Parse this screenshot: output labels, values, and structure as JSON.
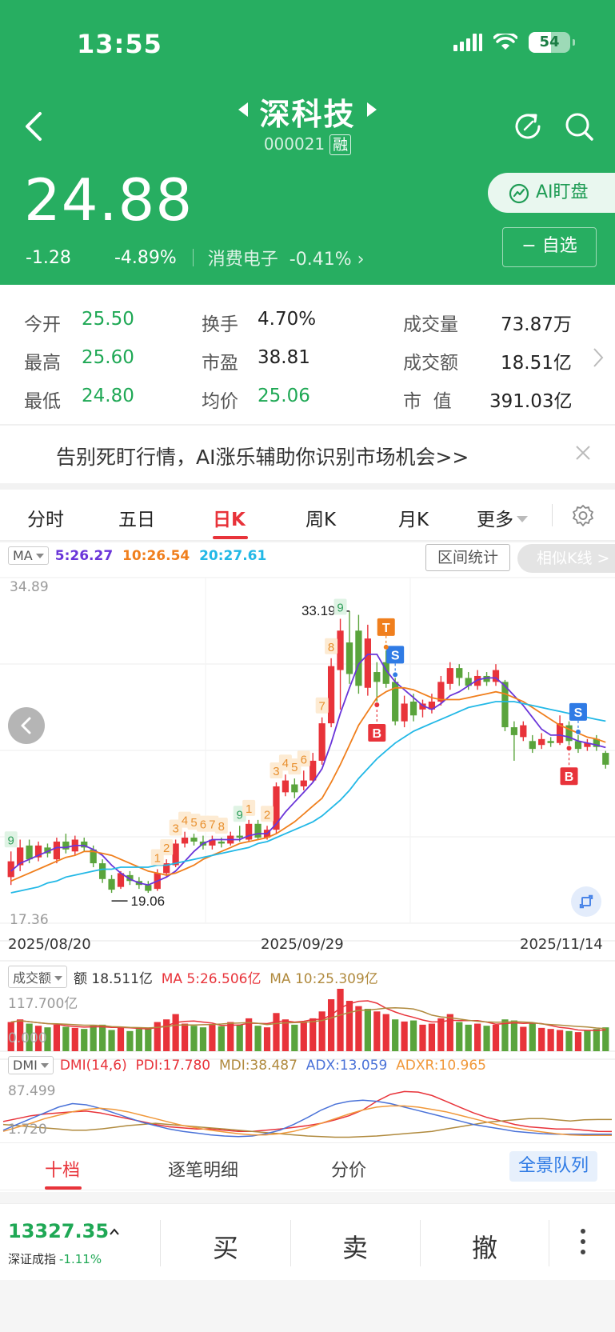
{
  "status_bar": {
    "time": "13:55",
    "battery": "54"
  },
  "header": {
    "stock_name": "深科技",
    "stock_code": "000021",
    "margin_tag": "融",
    "price": "24.88",
    "change": "-1.28",
    "change_pct": "-4.89%",
    "sector": "消费电子",
    "sector_pct": "-0.41%",
    "ai_button": "AI盯盘",
    "watchlist_button": "− 自选",
    "colors": {
      "header_bg": "#27ae61",
      "down": "#1fa855",
      "up": "#e8333a"
    }
  },
  "quote": {
    "items": [
      {
        "label": "今开",
        "value": "25.50"
      },
      {
        "label": "最高",
        "value": "25.60"
      },
      {
        "label": "最低",
        "value": "24.80"
      },
      {
        "label": "换手",
        "value": "4.70%"
      },
      {
        "label": "市盈",
        "value": "38.81"
      },
      {
        "label": "均价",
        "value": "25.06"
      },
      {
        "label": "成交量",
        "value": "73.87万"
      },
      {
        "label": "成交额",
        "value": "18.51亿"
      },
      {
        "label": "市  值",
        "value": "391.03亿"
      }
    ]
  },
  "banner": {
    "text": "告别死盯行情，AI涨乐辅助你识别市场机会>>"
  },
  "period_tabs": {
    "items": [
      "分时",
      "五日",
      "日K",
      "周K",
      "月K",
      "更多"
    ],
    "active": "日K"
  },
  "kline": {
    "ma_selector": "MA",
    "ma5": "5:26.27",
    "ma10": "10:26.54",
    "ma20": "20:27.61",
    "range_stats_button": "区间统计",
    "similar_kline_button": "相似K线 >",
    "y_max": "34.89",
    "y_min": "17.36",
    "high_mark": "33.19",
    "low_mark": "19.06",
    "x_labels": [
      "2025/08/20",
      "2025/09/29",
      "2025/11/14"
    ],
    "signals": {
      "buy": "B",
      "sell": "S",
      "t": "T"
    },
    "counts": [
      "9",
      "1",
      "2",
      "3",
      "4",
      "5",
      "6",
      "7",
      "8",
      "9",
      "1",
      "2",
      "3",
      "4",
      "5",
      "6",
      "7",
      "8",
      "9"
    ],
    "colors": {
      "ma5": "#6a35d9",
      "ma10": "#f07f1d",
      "ma20": "#22b8e6"
    }
  },
  "volume": {
    "selector": "成交额",
    "amount": "额 18.511亿",
    "ma5": "MA 5:26.506亿",
    "ma10": "MA 10:25.309亿",
    "y_max": "117.700亿",
    "y_min": "0.000"
  },
  "dmi": {
    "selector": "DMI",
    "params": "DMI(14,6)",
    "pdi": "PDI:17.780",
    "mdi": "MDI:38.487",
    "adx": "ADX:13.059",
    "adxr": "ADXR:10.965",
    "y_max": "87.499",
    "y_min": "1.720"
  },
  "bottom_tabs": {
    "items": [
      "十档",
      "逐笔明细",
      "分价"
    ],
    "active": "十档",
    "panorama": "全景队列"
  },
  "bottom_bar": {
    "index_value": "13327.35",
    "index_name": "深证成指",
    "index_pct": "-1.11%",
    "buy": "买",
    "sell": "卖",
    "cancel": "撤"
  },
  "chart_data": {
    "type": "candlestick",
    "title": "深科技 日K",
    "xlabel": "",
    "ylabel": "",
    "ylim": [
      17.36,
      34.89
    ],
    "x_ticks": [
      "2025/08/20",
      "2025/09/29",
      "2025/11/14"
    ],
    "candles": [
      {
        "o": 19.7,
        "c": 20.5,
        "h": 21.0,
        "l": 19.3
      },
      {
        "o": 20.3,
        "c": 21.2,
        "h": 21.6,
        "l": 20.0
      },
      {
        "o": 21.3,
        "c": 20.6,
        "h": 21.6,
        "l": 20.4
      },
      {
        "o": 20.7,
        "c": 21.3,
        "h": 21.5,
        "l": 20.5
      },
      {
        "o": 21.2,
        "c": 20.9,
        "h": 21.4,
        "l": 20.7
      },
      {
        "o": 20.6,
        "c": 21.5,
        "h": 21.7,
        "l": 20.4
      },
      {
        "o": 21.5,
        "c": 21.1,
        "h": 21.9,
        "l": 20.9
      },
      {
        "o": 21.0,
        "c": 21.6,
        "h": 21.8,
        "l": 20.8
      },
      {
        "o": 21.5,
        "c": 21.2,
        "h": 21.7,
        "l": 21.0
      },
      {
        "o": 21.1,
        "c": 20.4,
        "h": 21.3,
        "l": 20.2
      },
      {
        "o": 20.4,
        "c": 19.6,
        "h": 20.6,
        "l": 19.4
      },
      {
        "o": 19.6,
        "c": 19.06,
        "h": 19.8,
        "l": 18.9
      },
      {
        "o": 19.2,
        "c": 19.9,
        "h": 20.0,
        "l": 19.1
      },
      {
        "o": 19.8,
        "c": 19.5,
        "h": 20.0,
        "l": 19.3
      },
      {
        "o": 19.5,
        "c": 19.3,
        "h": 19.7,
        "l": 19.1
      },
      {
        "o": 19.3,
        "c": 19.0,
        "h": 19.5,
        "l": 18.9
      },
      {
        "o": 19.1,
        "c": 19.9,
        "h": 20.1,
        "l": 19.0
      },
      {
        "o": 19.9,
        "c": 20.4,
        "h": 20.6,
        "l": 19.7
      },
      {
        "o": 20.3,
        "c": 21.4,
        "h": 21.6,
        "l": 20.2
      },
      {
        "o": 21.4,
        "c": 21.7,
        "h": 22.0,
        "l": 21.2
      },
      {
        "o": 21.7,
        "c": 21.5,
        "h": 21.9,
        "l": 21.3
      },
      {
        "o": 21.5,
        "c": 21.3,
        "h": 21.8,
        "l": 21.1
      },
      {
        "o": 21.3,
        "c": 21.6,
        "h": 21.8,
        "l": 21.1
      },
      {
        "o": 21.5,
        "c": 21.4,
        "h": 21.7,
        "l": 21.2
      },
      {
        "o": 21.4,
        "c": 21.8,
        "h": 22.0,
        "l": 21.3
      },
      {
        "o": 21.8,
        "c": 21.7,
        "h": 22.3,
        "l": 21.5
      },
      {
        "o": 21.6,
        "c": 22.4,
        "h": 22.6,
        "l": 21.5
      },
      {
        "o": 22.4,
        "c": 21.7,
        "h": 22.6,
        "l": 21.6
      },
      {
        "o": 21.7,
        "c": 22.1,
        "h": 22.3,
        "l": 21.6
      },
      {
        "o": 22.1,
        "c": 24.3,
        "h": 24.5,
        "l": 21.9
      },
      {
        "o": 24.0,
        "c": 24.6,
        "h": 24.9,
        "l": 23.8
      },
      {
        "o": 24.4,
        "c": 24.0,
        "h": 24.7,
        "l": 23.7
      },
      {
        "o": 24.3,
        "c": 24.6,
        "h": 25.1,
        "l": 24.1
      },
      {
        "o": 24.6,
        "c": 25.6,
        "h": 26.0,
        "l": 24.5
      },
      {
        "o": 25.6,
        "c": 27.5,
        "h": 27.8,
        "l": 25.4
      },
      {
        "o": 27.5,
        "c": 30.4,
        "h": 30.8,
        "l": 27.3
      },
      {
        "o": 30.2,
        "c": 32.2,
        "h": 32.8,
        "l": 28.2
      },
      {
        "o": 31.6,
        "c": 30.0,
        "h": 33.19,
        "l": 29.5
      },
      {
        "o": 32.2,
        "c": 29.4,
        "h": 33.0,
        "l": 29.0
      },
      {
        "o": 29.3,
        "c": 31.8,
        "h": 32.5,
        "l": 28.9
      },
      {
        "o": 30.1,
        "c": 29.6,
        "h": 30.6,
        "l": 28.6
      },
      {
        "o": 30.6,
        "c": 29.5,
        "h": 31.2,
        "l": 29.3
      },
      {
        "o": 29.6,
        "c": 27.6,
        "h": 29.8,
        "l": 27.4
      },
      {
        "o": 27.6,
        "c": 28.5,
        "h": 28.9,
        "l": 27.3
      },
      {
        "o": 28.6,
        "c": 27.9,
        "h": 29.0,
        "l": 27.6
      },
      {
        "o": 28.2,
        "c": 28.5,
        "h": 28.7,
        "l": 27.8
      },
      {
        "o": 28.2,
        "c": 28.6,
        "h": 29.0,
        "l": 28.0
      },
      {
        "o": 28.6,
        "c": 29.6,
        "h": 29.9,
        "l": 28.4
      },
      {
        "o": 29.5,
        "c": 30.3,
        "h": 30.6,
        "l": 29.2
      },
      {
        "o": 30.3,
        "c": 29.8,
        "h": 30.5,
        "l": 29.4
      },
      {
        "o": 29.8,
        "c": 29.4,
        "h": 30.1,
        "l": 29.2
      },
      {
        "o": 29.4,
        "c": 29.9,
        "h": 30.2,
        "l": 29.2
      },
      {
        "o": 29.9,
        "c": 29.6,
        "h": 30.1,
        "l": 29.4
      },
      {
        "o": 29.6,
        "c": 30.2,
        "h": 30.5,
        "l": 29.4
      },
      {
        "o": 29.6,
        "c": 27.3,
        "h": 29.7,
        "l": 27.1
      },
      {
        "o": 27.3,
        "c": 26.9,
        "h": 27.6,
        "l": 25.6
      },
      {
        "o": 26.8,
        "c": 27.4,
        "h": 27.6,
        "l": 26.6
      },
      {
        "o": 26.6,
        "c": 26.2,
        "h": 26.9,
        "l": 26.0
      },
      {
        "o": 26.4,
        "c": 26.7,
        "h": 27.0,
        "l": 26.2
      },
      {
        "o": 26.6,
        "c": 26.5,
        "h": 26.8,
        "l": 26.3
      },
      {
        "o": 26.5,
        "c": 27.5,
        "h": 27.9,
        "l": 26.4
      },
      {
        "o": 27.4,
        "c": 26.6,
        "h": 27.6,
        "l": 26.4
      },
      {
        "o": 26.6,
        "c": 26.2,
        "h": 26.9,
        "l": 26.0
      },
      {
        "o": 26.3,
        "c": 26.5,
        "h": 26.7,
        "l": 26.1
      },
      {
        "o": 26.7,
        "c": 26.3,
        "h": 26.9,
        "l": 26.1
      },
      {
        "o": 26.0,
        "c": 25.4,
        "h": 26.1,
        "l": 25.2
      }
    ],
    "series": [
      {
        "name": "MA5",
        "values": [
          20.0,
          20.4,
          20.6,
          20.8,
          21.0,
          21.2,
          21.2,
          21.3,
          21.3,
          21.1,
          20.8,
          20.3,
          19.9,
          19.6,
          19.4,
          19.3,
          19.5,
          19.7,
          20.0,
          20.5,
          21.0,
          21.4,
          21.6,
          21.6,
          21.6,
          21.6,
          21.8,
          21.9,
          21.9,
          22.4,
          23.0,
          23.5,
          24.0,
          24.5,
          25.2,
          26.5,
          28.0,
          29.3,
          30.5,
          31.0,
          31.0,
          30.2,
          29.6,
          29.2,
          28.8,
          28.4,
          28.2,
          28.5,
          28.9,
          29.1,
          29.4,
          29.7,
          29.8,
          29.8,
          29.4,
          28.9,
          28.4,
          27.8,
          27.2,
          26.9,
          26.9,
          26.8,
          26.6,
          26.5,
          26.4,
          26.27
        ]
      },
      {
        "name": "MA10",
        "values": [
          19.5,
          19.7,
          19.9,
          20.1,
          20.3,
          20.5,
          20.7,
          20.8,
          21.0,
          21.0,
          20.9,
          20.8,
          20.6,
          20.4,
          20.2,
          20.0,
          19.9,
          19.8,
          19.9,
          20.1,
          20.3,
          20.6,
          20.8,
          21.0,
          21.2,
          21.4,
          21.5,
          21.6,
          21.7,
          21.9,
          22.2,
          22.5,
          22.9,
          23.3,
          23.7,
          24.5,
          25.4,
          26.4,
          27.4,
          28.1,
          28.8,
          29.1,
          29.3,
          29.3,
          29.2,
          29.0,
          28.8,
          28.7,
          28.7,
          28.7,
          28.8,
          28.9,
          29.0,
          29.1,
          29.0,
          28.8,
          28.6,
          28.3,
          28.0,
          27.7,
          27.4,
          27.2,
          27.0,
          26.8,
          26.7,
          26.54
        ]
      },
      {
        "name": "MA20",
        "values": [
          18.9,
          19.0,
          19.1,
          19.2,
          19.4,
          19.5,
          19.7,
          19.8,
          19.9,
          20.0,
          20.1,
          20.1,
          20.2,
          20.2,
          20.2,
          20.2,
          20.3,
          20.3,
          20.4,
          20.5,
          20.6,
          20.7,
          20.8,
          20.9,
          21.0,
          21.1,
          21.2,
          21.4,
          21.5,
          21.7,
          21.9,
          22.1,
          22.3,
          22.5,
          22.8,
          23.2,
          23.6,
          24.1,
          24.7,
          25.2,
          25.7,
          26.1,
          26.5,
          26.8,
          27.1,
          27.3,
          27.5,
          27.7,
          27.9,
          28.1,
          28.3,
          28.4,
          28.5,
          28.6,
          28.6,
          28.6,
          28.5,
          28.4,
          28.3,
          28.2,
          28.1,
          28.0,
          27.9,
          27.8,
          27.7,
          27.61
        ]
      }
    ],
    "volume": [
      55,
      60,
      52,
      48,
      45,
      50,
      46,
      44,
      42,
      48,
      50,
      40,
      45,
      38,
      42,
      44,
      55,
      60,
      70,
      52,
      48,
      45,
      50,
      47,
      55,
      50,
      62,
      48,
      45,
      72,
      60,
      50,
      55,
      62,
      75,
      98,
      117.7,
      95,
      85,
      80,
      75,
      70,
      60,
      56,
      58,
      50,
      52,
      62,
      70,
      55,
      50,
      52,
      48,
      50,
      60,
      58,
      46,
      52,
      44,
      42,
      40,
      38,
      36,
      40,
      42,
      45
    ],
    "volume_up": [
      true,
      true,
      false,
      true,
      false,
      true,
      false,
      true,
      false,
      false,
      false,
      false,
      true,
      false,
      false,
      false,
      true,
      true,
      true,
      true,
      false,
      false,
      true,
      false,
      true,
      false,
      true,
      false,
      true,
      true,
      true,
      false,
      true,
      true,
      true,
      true,
      true,
      true,
      true,
      false,
      true,
      true,
      false,
      true,
      false,
      true,
      true,
      true,
      true,
      false,
      false,
      true,
      false,
      true,
      false,
      false,
      true,
      false,
      true,
      true,
      true,
      false,
      true,
      false,
      false,
      false
    ],
    "dmi": {
      "PDI": [
        35,
        40,
        45,
        48,
        50,
        52,
        53,
        50,
        45,
        40,
        35,
        30,
        26,
        24,
        22,
        22,
        20,
        18,
        18,
        20,
        22,
        25,
        28,
        32,
        38,
        45,
        55,
        70,
        82,
        87,
        86,
        80,
        70,
        60,
        50,
        42,
        36,
        30,
        26,
        24,
        22,
        22,
        20,
        18,
        17.78
      ],
      "MDI": [
        30,
        28,
        26,
        24,
        22,
        20,
        20,
        22,
        25,
        28,
        30,
        32,
        30,
        28,
        26,
        24,
        22,
        20,
        18,
        16,
        14,
        12,
        10,
        9,
        8,
        8,
        9,
        10,
        12,
        14,
        16,
        18,
        22,
        26,
        30,
        34,
        36,
        38,
        40,
        40,
        38,
        36,
        38,
        38.487,
        38.487
      ],
      "ADX": [
        20,
        30,
        40,
        50,
        60,
        66,
        64,
        58,
        50,
        42,
        34,
        28,
        22,
        18,
        15,
        12,
        10,
        9,
        10,
        14,
        20,
        30,
        42,
        55,
        65,
        70,
        72,
        70,
        66,
        60,
        54,
        48,
        42,
        36,
        30,
        26,
        22,
        18,
        16,
        14,
        13,
        13,
        13,
        13.059,
        13.059
      ],
      "ADXR": [
        18,
        25,
        32,
        40,
        46,
        52,
        56,
        58,
        56,
        52,
        46,
        40,
        34,
        28,
        24,
        20,
        17,
        14,
        12,
        12,
        14,
        18,
        24,
        32,
        40,
        48,
        55,
        60,
        62,
        62,
        60,
        56,
        52,
        46,
        40,
        34,
        28,
        24,
        20,
        17,
        14,
        12,
        11,
        10.965,
        10.965
      ]
    }
  }
}
